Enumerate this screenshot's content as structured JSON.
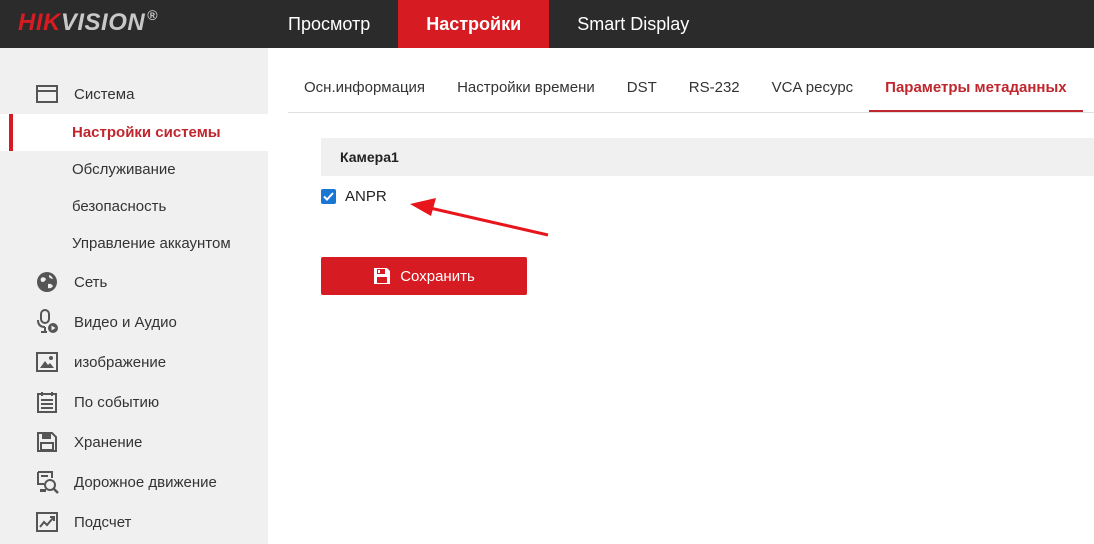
{
  "brand": {
    "hik": "HIK",
    "vision": "VISION",
    "reg": "®"
  },
  "topnav": [
    {
      "label": "Просмотр",
      "active": false
    },
    {
      "label": "Настройки",
      "active": true
    },
    {
      "label": "Smart Display",
      "active": false
    }
  ],
  "sidebar": {
    "system": {
      "label": "Система",
      "icon": "monitor-icon"
    },
    "sub_items": [
      {
        "label": "Настройки системы",
        "active": true
      },
      {
        "label": "Обслуживание",
        "active": false
      },
      {
        "label": "безопасность",
        "active": false
      },
      {
        "label": "Управление аккаунтом",
        "active": false
      }
    ],
    "items": [
      {
        "label": "Сеть",
        "icon": "globe-icon"
      },
      {
        "label": "Видео и Аудио",
        "icon": "microphone-icon"
      },
      {
        "label": "изображение",
        "icon": "image-icon"
      },
      {
        "label": "По событию",
        "icon": "calendar-icon"
      },
      {
        "label": "Хранение",
        "icon": "save-icon"
      },
      {
        "label": "Дорожное движение",
        "icon": "traffic-icon"
      },
      {
        "label": "Подсчет",
        "icon": "chart-icon"
      }
    ]
  },
  "tabs": [
    {
      "label": "Осн.информация",
      "active": false
    },
    {
      "label": "Настройки времени",
      "active": false
    },
    {
      "label": "DST",
      "active": false
    },
    {
      "label": "RS-232",
      "active": false
    },
    {
      "label": "VCA ресурс",
      "active": false
    },
    {
      "label": "Параметры метаданных",
      "active": true
    }
  ],
  "content": {
    "camera_header": "Камера1",
    "anpr": {
      "label": "ANPR",
      "checked": true
    },
    "save_label": "Сохранить"
  },
  "colors": {
    "accent": "#d71b22",
    "topbar": "#2b2b2b",
    "sidebar": "#f0f0f0",
    "checkbox": "#1976d2"
  }
}
